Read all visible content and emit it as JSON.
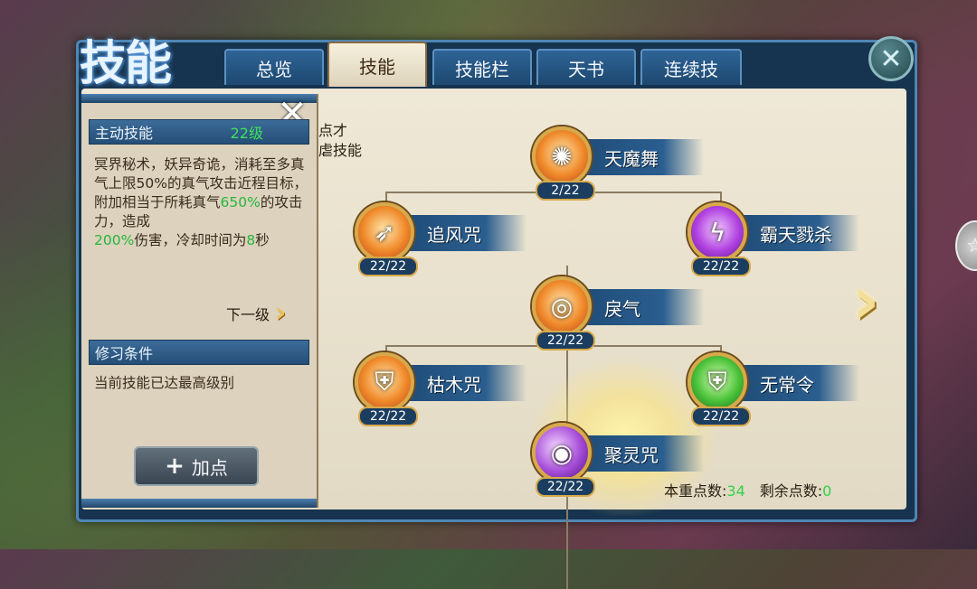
{
  "window": {
    "title": "技能"
  },
  "tabs": [
    {
      "label": "总览"
    },
    {
      "label": "技能"
    },
    {
      "label": "技能栏"
    },
    {
      "label": "天书"
    },
    {
      "label": "连续技"
    }
  ],
  "panel": {
    "skill_type": "主动技能",
    "level": "22级",
    "description": {
      "p1": "冥界秘术，妖异奇诡，消耗至多真气上限50%的真气攻击近程目标，附加相当于所耗真气",
      "v1": "650%",
      "p2": "的攻击力，造成",
      "v2": "200%",
      "p3": "伤害，冷却时间为",
      "v3": "8",
      "p4": "秒"
    },
    "next_level": "下一级",
    "condition_header": "修习条件",
    "condition_text": "当前技能已达最高级别",
    "add_point": "加点"
  },
  "hint": {
    "line1": "点才",
    "line2": "虐技能"
  },
  "skills": [
    {
      "name": "天魔舞",
      "level": "2/22",
      "icon": "fire-dance-icon"
    },
    {
      "name": "追风咒",
      "level": "22/22",
      "icon": "wind-chase-icon"
    },
    {
      "name": "霸天戮杀",
      "level": "22/22",
      "icon": "lightning-icon"
    },
    {
      "name": "戾气",
      "level": "22/22",
      "icon": "fury-icon"
    },
    {
      "name": "枯木咒",
      "level": "22/22",
      "icon": "shield-icon"
    },
    {
      "name": "无常令",
      "level": "22/22",
      "icon": "green-shield-icon"
    },
    {
      "name": "聚灵咒",
      "level": "22/22",
      "icon": "spirit-orb-icon"
    }
  ],
  "points": {
    "reset_label": "本重点数:",
    "reset_value": "34",
    "remaining_label": "剩余点数:",
    "remaining_value": "0"
  }
}
